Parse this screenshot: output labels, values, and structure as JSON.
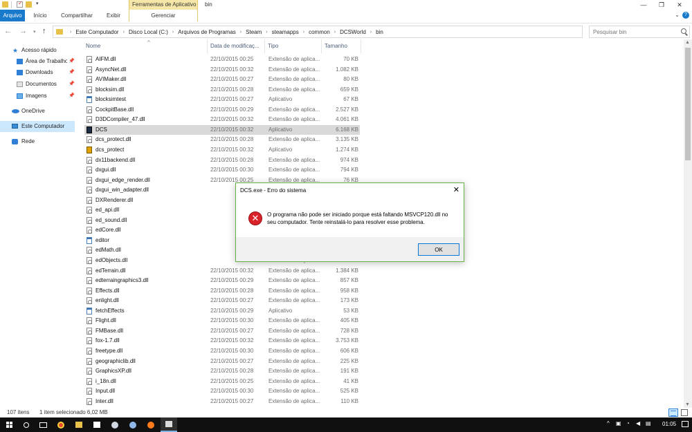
{
  "ribbon": {
    "context_group": "Ferramentas de Aplicativo",
    "window_title": "bin",
    "tabs": [
      {
        "label": "Arquivo"
      },
      {
        "label": "Início"
      },
      {
        "label": "Compartilhar"
      },
      {
        "label": "Exibir"
      },
      {
        "label": "Gerenciar"
      }
    ]
  },
  "address": {
    "crumbs": [
      "Este Computador",
      "Disco Local (C:)",
      "Arquivos de Programas",
      "Steam",
      "steamapps",
      "common",
      "DCSWorld",
      "bin"
    ]
  },
  "search": {
    "placeholder": "Pesquisar bin"
  },
  "sidebar": {
    "items": [
      {
        "label": "Acesso rápido",
        "icon": "star-icon"
      },
      {
        "label": "Área de Trabalho",
        "icon": "desktop-icon",
        "pinned": true
      },
      {
        "label": "Downloads",
        "icon": "download-icon",
        "pinned": true
      },
      {
        "label": "Documentos",
        "icon": "documents-icon",
        "pinned": true
      },
      {
        "label": "Imagens",
        "icon": "pictures-icon",
        "pinned": true
      },
      {
        "label": "OneDrive",
        "icon": "onedrive-icon"
      },
      {
        "label": "Este Computador",
        "icon": "computer-icon",
        "selected": true
      },
      {
        "label": "Rede",
        "icon": "network-icon"
      }
    ]
  },
  "columns": {
    "name": "Nome",
    "date": "Data de modificaç...",
    "type": "Tipo",
    "size": "Tamanho"
  },
  "files": [
    {
      "name": "AIFM.dll",
      "date": "22/10/2015 00:25",
      "type": "Extensão de aplica...",
      "size": "70 KB",
      "kind": "dll"
    },
    {
      "name": "AsyncNet.dll",
      "date": "22/10/2015 00:32",
      "type": "Extensão de aplica...",
      "size": "1.082 KB",
      "kind": "dll"
    },
    {
      "name": "AVIMaker.dll",
      "date": "22/10/2015 00:27",
      "type": "Extensão de aplica...",
      "size": "80 KB",
      "kind": "dll"
    },
    {
      "name": "blocksim.dll",
      "date": "22/10/2015 00:28",
      "type": "Extensão de aplica...",
      "size": "659 KB",
      "kind": "dll"
    },
    {
      "name": "blocksimtest",
      "date": "22/10/2015 00:27",
      "type": "Aplicativo",
      "size": "67 KB",
      "kind": "app"
    },
    {
      "name": "CockpitBase.dll",
      "date": "22/10/2015 00:29",
      "type": "Extensão de aplica...",
      "size": "2.527 KB",
      "kind": "dll"
    },
    {
      "name": "D3DCompiler_47.dll",
      "date": "22/10/2015 00:32",
      "type": "Extensão de aplica...",
      "size": "4.061 KB",
      "kind": "dll"
    },
    {
      "name": "DCS",
      "date": "22/10/2015 00:32",
      "type": "Aplicativo",
      "size": "6.168 KB",
      "kind": "dcs",
      "selected": true
    },
    {
      "name": "dcs_protect.dll",
      "date": "22/10/2015 00:28",
      "type": "Extensão de aplica...",
      "size": "3.135 KB",
      "kind": "dll"
    },
    {
      "name": "dcs_protect",
      "date": "22/10/2015 00:32",
      "type": "Aplicativo",
      "size": "1.274 KB",
      "kind": "prot"
    },
    {
      "name": "dx11backend.dll",
      "date": "22/10/2015 00:28",
      "type": "Extensão de aplica...",
      "size": "974 KB",
      "kind": "dll"
    },
    {
      "name": "dxgui.dll",
      "date": "22/10/2015 00:30",
      "type": "Extensão de aplica...",
      "size": "794 KB",
      "kind": "dll"
    },
    {
      "name": "dxgui_edge_render.dll",
      "date": "22/10/2015 00:25",
      "type": "Extensão de aplica...",
      "size": "76 KB",
      "kind": "dll"
    },
    {
      "name": "dxgui_win_adapter.dll",
      "date": "",
      "type": "",
      "size": "",
      "kind": "dll"
    },
    {
      "name": "DXRenderer.dll",
      "date": "",
      "type": "",
      "size": "",
      "kind": "dll"
    },
    {
      "name": "ed_api.dll",
      "date": "",
      "type": "",
      "size": "",
      "kind": "dll"
    },
    {
      "name": "ed_sound.dll",
      "date": "",
      "type": "",
      "size": "",
      "kind": "dll"
    },
    {
      "name": "edCore.dll",
      "date": "",
      "type": "",
      "size": "",
      "kind": "dll"
    },
    {
      "name": "editor",
      "date": "",
      "type": "",
      "size": "",
      "kind": "app"
    },
    {
      "name": "edMath.dll",
      "date": "",
      "type": "",
      "size": "",
      "kind": "dll"
    },
    {
      "name": "edObjects.dll",
      "date": "",
      "type": "Extensão de aplica...",
      "size": "585 KB",
      "kind": "dll"
    },
    {
      "name": "edTerrain.dll",
      "date": "22/10/2015 00:32",
      "type": "Extensão de aplica...",
      "size": "1.384 KB",
      "kind": "dll"
    },
    {
      "name": "edterraingraphics3.dll",
      "date": "22/10/2015 00:29",
      "type": "Extensão de aplica...",
      "size": "857 KB",
      "kind": "dll"
    },
    {
      "name": "Effects.dll",
      "date": "22/10/2015 00:28",
      "type": "Extensão de aplica...",
      "size": "958 KB",
      "kind": "dll"
    },
    {
      "name": "enlight.dll",
      "date": "22/10/2015 00:27",
      "type": "Extensão de aplica...",
      "size": "173 KB",
      "kind": "dll"
    },
    {
      "name": "fetchEffects",
      "date": "22/10/2015 00:29",
      "type": "Aplicativo",
      "size": "53 KB",
      "kind": "app"
    },
    {
      "name": "Flight.dll",
      "date": "22/10/2015 00:30",
      "type": "Extensão de aplica...",
      "size": "405 KB",
      "kind": "dll"
    },
    {
      "name": "FMBase.dll",
      "date": "22/10/2015 00:27",
      "type": "Extensão de aplica...",
      "size": "728 KB",
      "kind": "dll"
    },
    {
      "name": "fox-1.7.dll",
      "date": "22/10/2015 00:32",
      "type": "Extensão de aplica...",
      "size": "3.753 KB",
      "kind": "dll"
    },
    {
      "name": "freetype.dll",
      "date": "22/10/2015 00:30",
      "type": "Extensão de aplica...",
      "size": "606 KB",
      "kind": "dll"
    },
    {
      "name": "geographiclib.dll",
      "date": "22/10/2015 00:27",
      "type": "Extensão de aplica...",
      "size": "225 KB",
      "kind": "dll"
    },
    {
      "name": "GraphicsXP.dll",
      "date": "22/10/2015 00:28",
      "type": "Extensão de aplica...",
      "size": "191 KB",
      "kind": "dll"
    },
    {
      "name": "i_18n.dll",
      "date": "22/10/2015 00:25",
      "type": "Extensão de aplica...",
      "size": "41 KB",
      "kind": "dll"
    },
    {
      "name": "Input.dll",
      "date": "22/10/2015 00:30",
      "type": "Extensão de aplica...",
      "size": "525 KB",
      "kind": "dll"
    },
    {
      "name": "Inter.dll",
      "date": "22/10/2015 00:27",
      "type": "Extensão de aplica...",
      "size": "110 KB",
      "kind": "dll"
    }
  ],
  "status": {
    "count": "107 itens",
    "selection": "1 item selecionado  6,02 MB"
  },
  "dialog": {
    "title": "DCS.exe - Erro do sistema",
    "message": "O programa não pode ser iniciado porque está faltando MSVCP120.dll no seu computador. Tente reinstalá-lo para resolver esse problema.",
    "ok_label": "OK"
  },
  "taskbar": {
    "clock": "01:05",
    "apps": [
      {
        "name": "chrome-icon",
        "color": "#e7472b"
      },
      {
        "name": "file-explorer-icon",
        "color": "#e8c14a"
      },
      {
        "name": "store-icon",
        "color": "#ffffff"
      },
      {
        "name": "steam-icon",
        "color": "#cfd8e3"
      },
      {
        "name": "dcs-icon",
        "color": "#8fb8e8"
      },
      {
        "name": "gear-app-icon",
        "color": "#ff7a1a"
      },
      {
        "name": "explorer-window-icon",
        "color": "#dcdcdc"
      }
    ]
  },
  "colors": {
    "accent": "#1979ca",
    "selection": "#cce8ff",
    "error": "#d8232a",
    "dialog_border": "#65b045"
  }
}
